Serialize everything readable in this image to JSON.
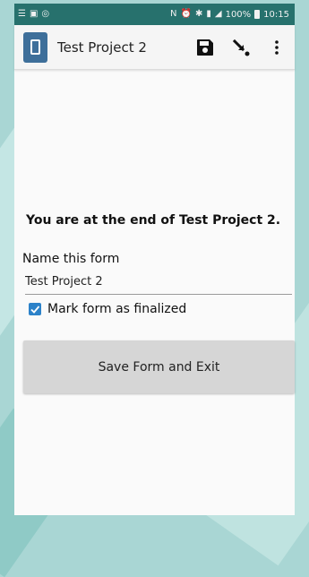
{
  "status_bar": {
    "battery": "100%",
    "time": "10:15"
  },
  "toolbar": {
    "title": "Test Project 2"
  },
  "form_end": {
    "message": "You are at the end of Test Project 2.",
    "name_label": "Name this form",
    "name_value": "Test Project 2",
    "finalized_label": "Mark form as finalized",
    "finalized_checked": true,
    "save_button": "Save Form and Exit"
  },
  "colors": {
    "status_bar": "#27716d",
    "app_icon": "#3e6f9a",
    "checkbox": "#2c82c9",
    "button": "#d6d6d6"
  }
}
